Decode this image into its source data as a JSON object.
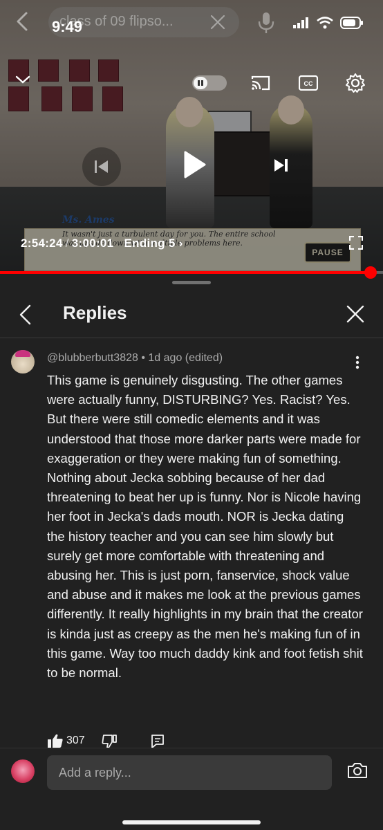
{
  "status_bar": {
    "time": "9:49"
  },
  "search": {
    "query": "class of 09 flipso..."
  },
  "player": {
    "current_time": "2:54:24",
    "separator": "/",
    "duration": "3:00:01",
    "chapter": "Ending 5",
    "progress": 0.967,
    "game_dialog": {
      "speaker": "Ms. Ames",
      "text": "It wasn't just a turbulent day for you. The entire school was upside down with multiple problems here.",
      "pause_label": "PAUSE"
    }
  },
  "panel": {
    "title": "Replies",
    "comment": {
      "author": "@blubberbutt3828",
      "meta": "1d ago (edited)",
      "body": "This game is genuinely disgusting. The other games were actually funny, DISTURBING? Yes. Racist? Yes. But there were still comedic elements and it was understood that those more darker parts were made for exaggeration or they were making fun of something. Nothing about Jecka sobbing because of her dad threatening to beat her up is funny. Nor is Nicole having her foot in Jecka's dads mouth. NOR is Jecka dating the history teacher and you can see him slowly but surely get more comfortable with threatening and abusing her. This is just porn, fanservice, shock value and abuse and it makes me look at the previous games differently. It really highlights in my brain that the creator is kinda just as creepy as the men he's making fun of in this game. Way too much daddy kink and foot fetish shit to be normal.",
      "likes": "307"
    },
    "reply": {
      "placeholder": "Add a reply..."
    }
  }
}
